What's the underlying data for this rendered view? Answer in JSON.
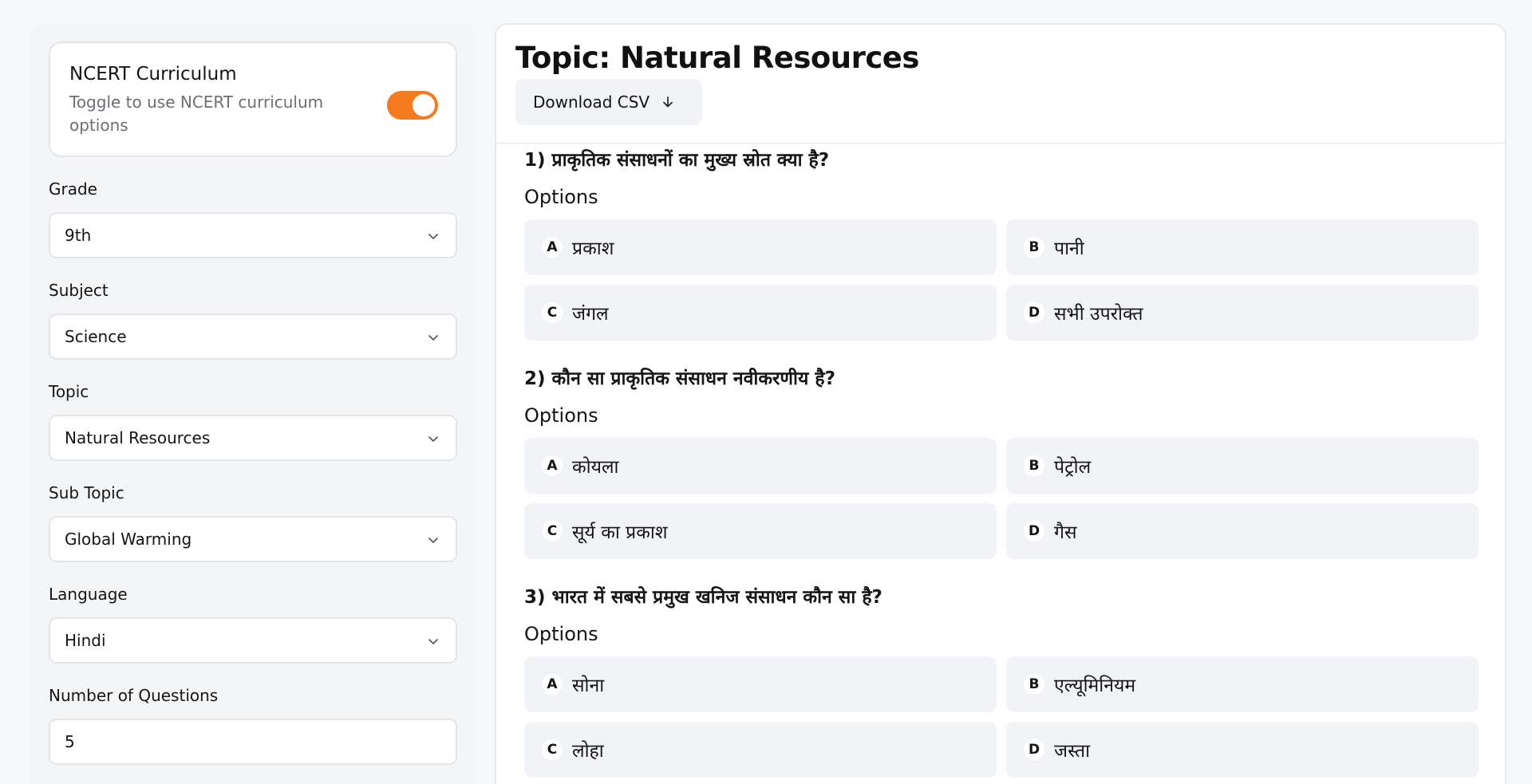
{
  "sidebar": {
    "ncert": {
      "title": "NCERT Curriculum",
      "subtitle": "Toggle to use NCERT curriculum options",
      "enabled": true
    },
    "fields": {
      "grade": {
        "label": "Grade",
        "value": "9th"
      },
      "subject": {
        "label": "Subject",
        "value": "Science"
      },
      "topic": {
        "label": "Topic",
        "value": "Natural Resources"
      },
      "subtopic": {
        "label": "Sub Topic",
        "value": "Global Warming"
      },
      "language": {
        "label": "Language",
        "value": "Hindi"
      },
      "num_questions": {
        "label": "Number of Questions",
        "value": "5"
      }
    }
  },
  "main": {
    "title": "Topic: Natural Resources",
    "download_label": "Download CSV",
    "options_label": "Options",
    "questions": [
      {
        "text": "1) प्राकृतिक संसाधनों का मुख्य स्रोत क्या है?",
        "options": [
          {
            "letter": "A",
            "text": "प्रकाश"
          },
          {
            "letter": "B",
            "text": "पानी"
          },
          {
            "letter": "C",
            "text": "जंगल"
          },
          {
            "letter": "D",
            "text": "सभी उपरोक्त"
          }
        ]
      },
      {
        "text": "2) कौन सा प्राकृतिक संसाधन नवीकरणीय है?",
        "options": [
          {
            "letter": "A",
            "text": "कोयला"
          },
          {
            "letter": "B",
            "text": "पेट्रोल"
          },
          {
            "letter": "C",
            "text": "सूर्य का प्रकाश"
          },
          {
            "letter": "D",
            "text": "गैस"
          }
        ]
      },
      {
        "text": "3) भारत में सबसे प्रमुख खनिज संसाधन कौन सा है?",
        "options": [
          {
            "letter": "A",
            "text": "सोना"
          },
          {
            "letter": "B",
            "text": "एल्यूमिनियम"
          },
          {
            "letter": "C",
            "text": "लोहा"
          },
          {
            "letter": "D",
            "text": "जस्ता"
          }
        ]
      }
    ]
  },
  "colors": {
    "accent": "#f47b20"
  },
  "icons": {
    "dropdown": "chevron-down-icon",
    "download": "arrow-down-icon"
  }
}
